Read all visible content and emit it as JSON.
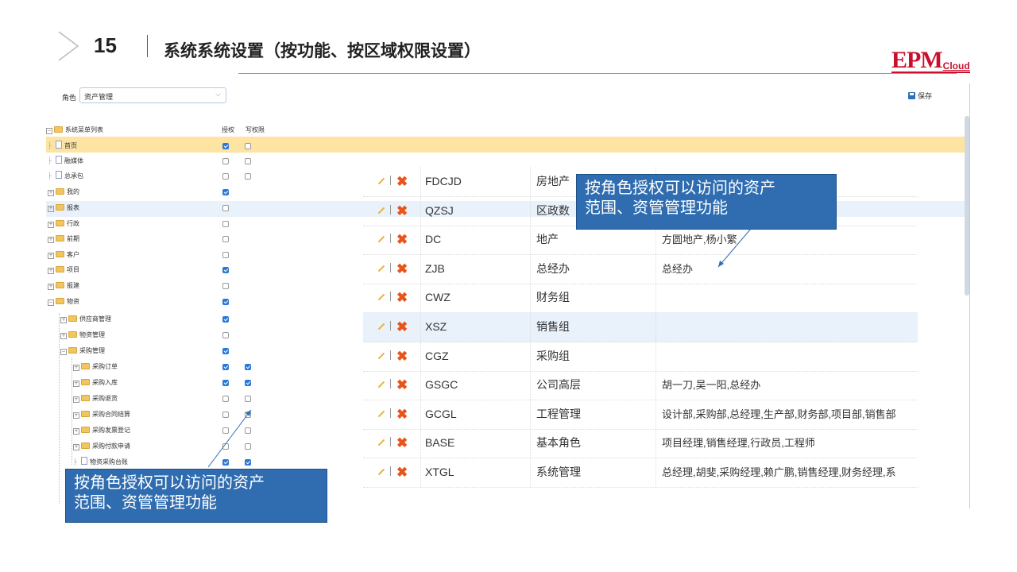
{
  "slide": {
    "number": "15",
    "title": "系统系统设置（按功能、按区域权限设置）",
    "logo_main": "EPM",
    "logo_sub": "Cloud"
  },
  "toolbar": {
    "role_label": "角色",
    "role_value": "资产管理",
    "save_label": "保存"
  },
  "tree": {
    "root_label": "系统菜单列表",
    "col_auth": "授权",
    "col_write": "写权限",
    "items": [
      {
        "label": "首页",
        "auth": true,
        "write": false
      },
      {
        "label": "融媒体",
        "auth": false,
        "write": false
      },
      {
        "label": "总承包",
        "auth": false,
        "write": false
      },
      {
        "label": "我的",
        "auth": true,
        "write": null
      },
      {
        "label": "报表",
        "auth": false,
        "write": null
      },
      {
        "label": "行政",
        "auth": false,
        "write": null
      },
      {
        "label": "前期",
        "auth": false,
        "write": null
      },
      {
        "label": "客户",
        "auth": false,
        "write": null
      },
      {
        "label": "项目",
        "auth": true,
        "write": null
      },
      {
        "label": "报建",
        "auth": false,
        "write": null
      },
      {
        "label": "物资",
        "auth": true,
        "write": null
      },
      {
        "label": "供应商管理",
        "auth": true,
        "write": null
      },
      {
        "label": "物资管理",
        "auth": false,
        "write": null
      },
      {
        "label": "采购管理",
        "auth": true,
        "write": null
      },
      {
        "label": "采购订单",
        "auth": true,
        "write": true
      },
      {
        "label": "采购入库",
        "auth": true,
        "write": true
      },
      {
        "label": "采购退货",
        "auth": false,
        "write": false
      },
      {
        "label": "采购合同结算",
        "auth": false,
        "write": false
      },
      {
        "label": "采购发票登记",
        "auth": false,
        "write": false
      },
      {
        "label": "采购付款申请",
        "auth": false,
        "write": false
      },
      {
        "label": "物资采购台账",
        "auth": true,
        "write": true
      }
    ]
  },
  "roles_table": [
    {
      "code": "FDCJD",
      "name": "房地产",
      "members": ""
    },
    {
      "code": "QZSJ",
      "name": "区政数",
      "members": ""
    },
    {
      "code": "DC",
      "name": "地产",
      "members": "方圆地产,杨小繁"
    },
    {
      "code": "ZJB",
      "name": "总经办",
      "members": "总经办"
    },
    {
      "code": "CWZ",
      "name": "财务组",
      "members": ""
    },
    {
      "code": "XSZ",
      "name": "销售组",
      "members": ""
    },
    {
      "code": "CGZ",
      "name": "采购组",
      "members": ""
    },
    {
      "code": "GSGC",
      "name": "公司高层",
      "members": "胡一刀,吴一阳,总经办"
    },
    {
      "code": "GCGL",
      "name": "工程管理",
      "members": "设计部,采购部,总经理,生产部,财务部,项目部,销售部"
    },
    {
      "code": "BASE",
      "name": "基本角色",
      "members": "项目经理,销售经理,行政员,工程师"
    },
    {
      "code": "XTGL",
      "name": "系统管理",
      "members": "总经理,胡斐,采购经理,赖广鹏,销售经理,财务经理,系"
    }
  ],
  "callouts": {
    "top_line1": "按角色授权可以访问的资产",
    "top_line2": "范围、资管管理功能",
    "bottom_line1": "按角色授权可以访问的资产",
    "bottom_line2": "范围、资管管理功能"
  }
}
